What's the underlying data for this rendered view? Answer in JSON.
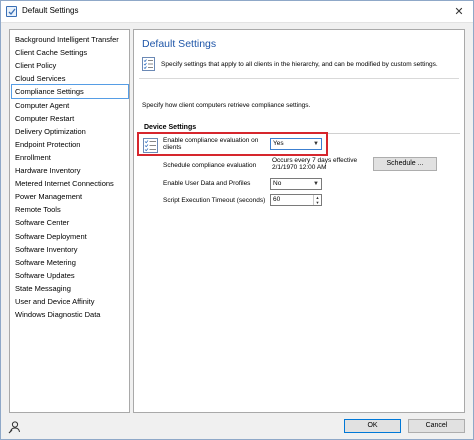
{
  "window": {
    "title": "Default Settings",
    "close_glyph": "✕"
  },
  "nav": {
    "items": [
      "Background Intelligent Transfer",
      "Client Cache Settings",
      "Client Policy",
      "Cloud Services",
      "Compliance Settings",
      "Computer Agent",
      "Computer Restart",
      "Delivery Optimization",
      "Endpoint Protection",
      "Enrollment",
      "Hardware Inventory",
      "Metered Internet Connections",
      "Power Management",
      "Remote Tools",
      "Software Center",
      "Software Deployment",
      "Software Inventory",
      "Software Metering",
      "Software Updates",
      "State Messaging",
      "User and Device Affinity",
      "Windows Diagnostic Data"
    ],
    "selected": "Compliance Settings"
  },
  "main": {
    "title": "Default Settings",
    "description": "Specify settings that apply to all clients in the hierarchy, and can be modified by custom settings.",
    "specify_text": "Specify how client computers retrieve compliance settings.",
    "group_title": "Device Settings",
    "settings": {
      "enable_compliance_label": "Enable compliance evaluation on clients",
      "enable_compliance_value": "Yes",
      "schedule_label": "Schedule compliance evaluation",
      "schedule_value_line1": "Occurs every 7 days effective",
      "schedule_value_line2": "2/1/1970 12:00 AM",
      "schedule_button": "Schedule ...",
      "enable_user_data_label": "Enable User Data and Profiles",
      "enable_user_data_value": "No",
      "script_timeout_label": "Script Execution Timeout (seconds)",
      "script_timeout_value": "60"
    }
  },
  "footer": {
    "ok": "OK",
    "cancel": "Cancel"
  },
  "icons": {
    "title": "settings-window-icon",
    "description": "checklist-icon",
    "setting": "checklist-icon",
    "bottom": "user-search-icon",
    "dropdown": "chevron-down-icon"
  },
  "colors": {
    "accent_title": "#1f56a8",
    "highlight_border": "#d6262d",
    "selection": "#569de5"
  }
}
